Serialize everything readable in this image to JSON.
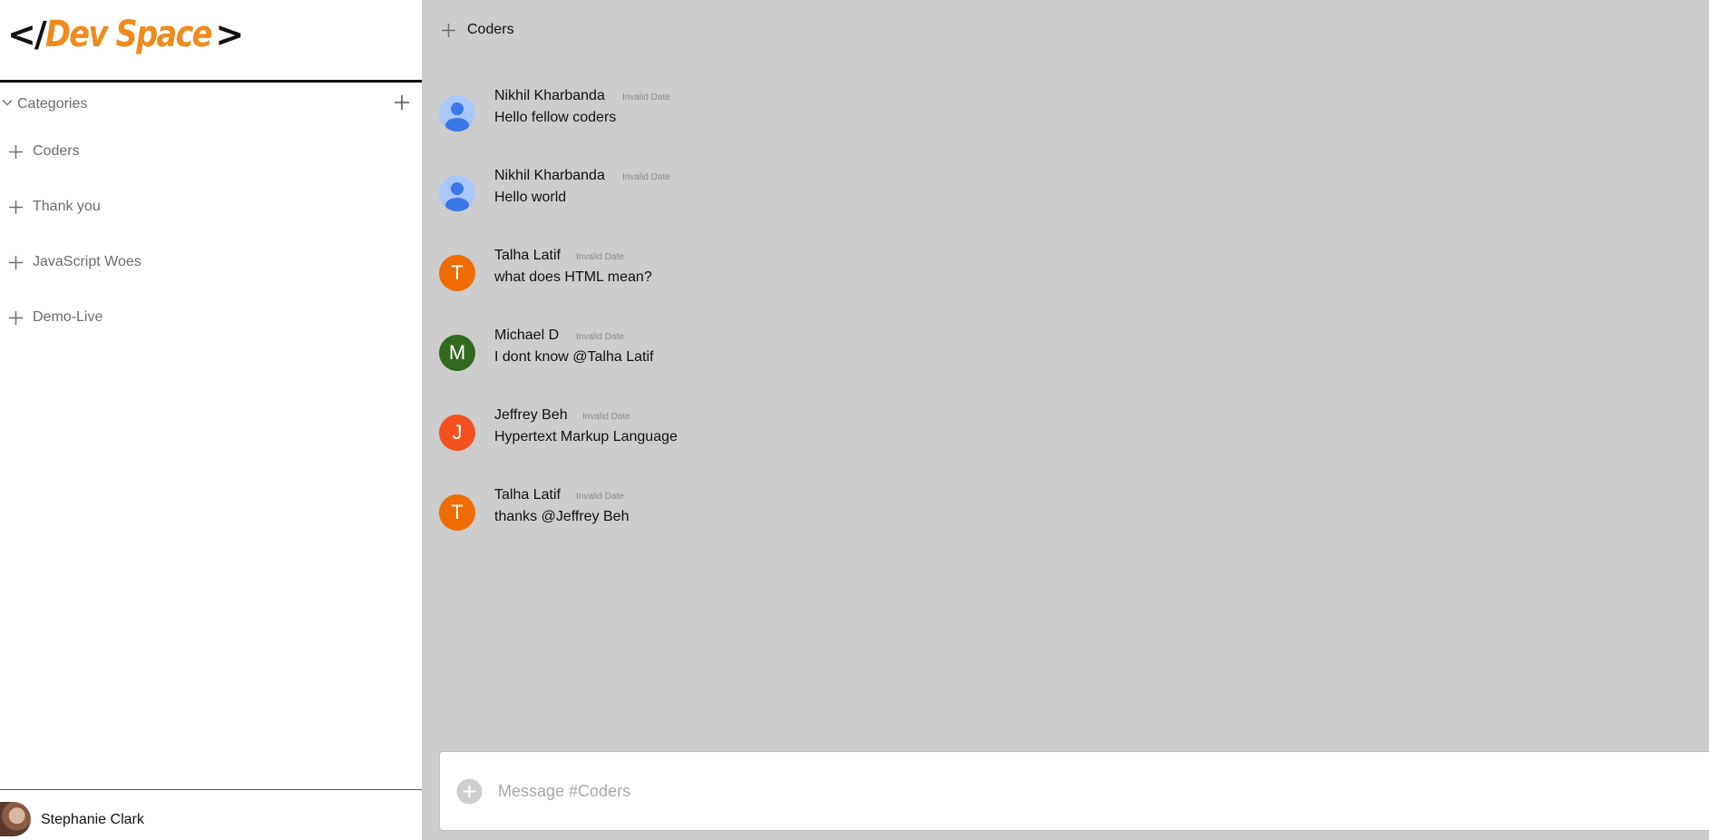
{
  "app": {
    "logo_left": "</",
    "logo_name": "Dev Space",
    "logo_right": ">",
    "brand_color": "#f08a1c"
  },
  "sidebar": {
    "categories_label": "Categories",
    "channels": [
      {
        "label": "Coders"
      },
      {
        "label": "Thank you"
      },
      {
        "label": "JavaScript Woes"
      },
      {
        "label": "Demo-Live"
      }
    ],
    "user": {
      "name": "Stephanie Clark"
    }
  },
  "chat": {
    "channel_name": "Coders",
    "messages": [
      {
        "author": "Nikhil Kharbanda",
        "time": "Invalid Date",
        "text": "Hello fellow coders",
        "avatar": "default-user-icon"
      },
      {
        "author": "Nikhil Kharbanda",
        "time": "Invalid Date",
        "text": "Hello world",
        "avatar": "default-user-icon"
      },
      {
        "author": "Talha Latif",
        "time": "Invalid Date",
        "text": "what does HTML mean?",
        "avatar": "T",
        "avatar_color": "#ef6c00"
      },
      {
        "author": "Michael D",
        "time": "Invalid Date",
        "text": "I dont know @Talha Latif",
        "avatar": "M",
        "avatar_color": "#33691e"
      },
      {
        "author": "Jeffrey Beh",
        "time": "Invalid Date",
        "text": "Hypertext Markup Language",
        "avatar": "J",
        "avatar_color": "#f4511e"
      },
      {
        "author": "Talha Latif",
        "time": "Invalid Date",
        "text": "thanks @Jeffrey Beh",
        "avatar": "T",
        "avatar_color": "#ef6c00"
      }
    ],
    "composer_placeholder": "Message #Coders"
  }
}
